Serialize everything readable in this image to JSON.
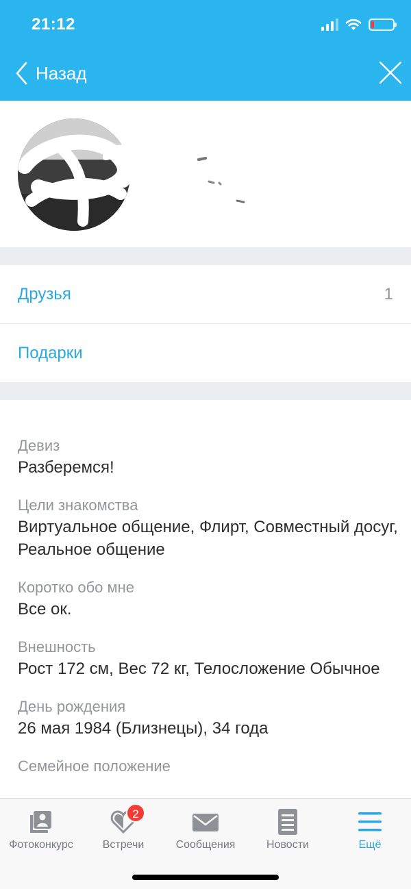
{
  "status": {
    "time": "21:12"
  },
  "header": {
    "back_label": "Назад"
  },
  "menu": [
    {
      "label": "Друзья",
      "count": "1"
    },
    {
      "label": "Подарки",
      "count": ""
    }
  ],
  "info": [
    {
      "label": "Девиз",
      "value": "Разберемся!"
    },
    {
      "label": "Цели знакомства",
      "value": "Виртуальное общение, Флирт, Совместный досуг, Реальное общение"
    },
    {
      "label": "Коротко обо мне",
      "value": "Все ок."
    },
    {
      "label": "Внешность",
      "value": "Рост 172 см, Вес 72 кг, Телосложение Обычное"
    },
    {
      "label": "День рождения",
      "value": "26 мая 1984 (Близнецы), 34 года"
    },
    {
      "label": "Семейное положение",
      "value": ""
    }
  ],
  "tabs": [
    {
      "label": "Фотоконкурс",
      "icon": "photo-contest-icon"
    },
    {
      "label": "Встречи",
      "icon": "heart-icon",
      "badge": "2"
    },
    {
      "label": "Сообщения",
      "icon": "envelope-icon"
    },
    {
      "label": "Новости",
      "icon": "news-icon"
    },
    {
      "label": "Ещё",
      "icon": "menu-icon",
      "active": true
    }
  ],
  "colors": {
    "accent": "#2bb5ee",
    "link": "#2aa9e0",
    "badge": "#f23c34"
  }
}
